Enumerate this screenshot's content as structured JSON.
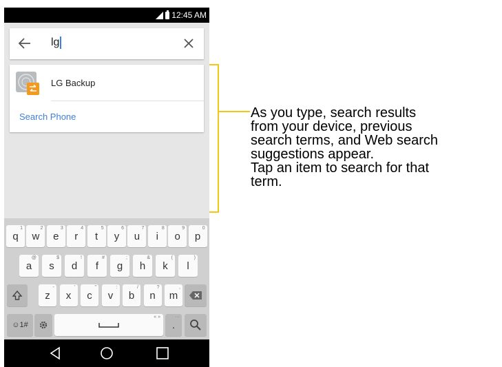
{
  "status_bar": {
    "time": "12:45 AM"
  },
  "search": {
    "query": "lg"
  },
  "results": {
    "items": [
      {
        "label": "LG Backup",
        "icon": "lg-backup-icon"
      }
    ],
    "search_phone_label": "Search Phone"
  },
  "keyboard": {
    "row1": [
      {
        "key": "q",
        "sub": "1"
      },
      {
        "key": "w",
        "sub": "2"
      },
      {
        "key": "e",
        "sub": "3"
      },
      {
        "key": "r",
        "sub": "4"
      },
      {
        "key": "t",
        "sub": "5"
      },
      {
        "key": "y",
        "sub": "6"
      },
      {
        "key": "u",
        "sub": "7"
      },
      {
        "key": "i",
        "sub": "8"
      },
      {
        "key": "o",
        "sub": "9"
      },
      {
        "key": "p",
        "sub": "0"
      }
    ],
    "row2": [
      {
        "key": "a",
        "sub": "@"
      },
      {
        "key": "s",
        "sub": "$"
      },
      {
        "key": "d",
        "sub": "!"
      },
      {
        "key": "f",
        "sub": "#"
      },
      {
        "key": "g",
        "sub": ";"
      },
      {
        "key": "h",
        "sub": "&"
      },
      {
        "key": "k",
        "sub": "("
      },
      {
        "key": "l",
        "sub": ")"
      }
    ],
    "row3": [
      {
        "key": "z",
        "sub": "-"
      },
      {
        "key": "x",
        "sub": "'"
      },
      {
        "key": "c",
        "sub": "\""
      },
      {
        "key": "v",
        "sub": ":"
      },
      {
        "key": "b",
        "sub": "/"
      },
      {
        "key": "n",
        "sub": "?"
      },
      {
        "key": "m",
        "sub": ","
      }
    ],
    "emoji_label": "☺1#",
    "period_label": ".",
    "period_sub": "···"
  },
  "annotation": {
    "text": "As you type, search results\nfrom your device, previous\nsearch terms, and Web search\nsuggestions appear.\nTap an item to search for that\nterm."
  },
  "colors": {
    "accent_link": "#3f7fd6",
    "bracket": "#f5c518",
    "cursor": "#3d7ee6"
  }
}
